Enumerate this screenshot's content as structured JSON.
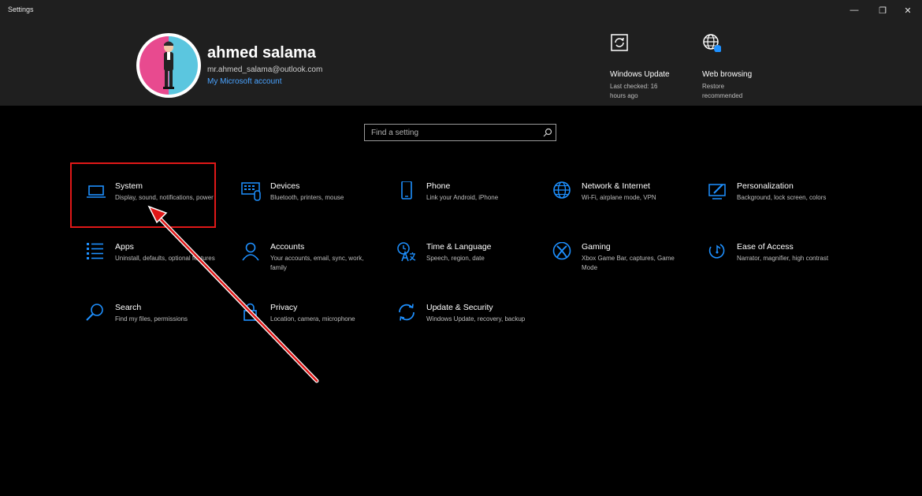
{
  "window": {
    "title": "Settings",
    "minimize": "—",
    "maximize": "❐",
    "close": "✕"
  },
  "account": {
    "name": "ahmed salama",
    "email": "mr.ahmed_salama@outlook.com",
    "link": "My Microsoft account"
  },
  "quick": [
    {
      "title": "Windows Update",
      "sub": "Last checked: 16 hours ago",
      "icon": "update-icon"
    },
    {
      "title": "Web browsing",
      "sub": "Restore recommended",
      "icon": "globe-icon"
    }
  ],
  "search": {
    "placeholder": "Find a setting"
  },
  "tiles": [
    {
      "name": "System",
      "desc": "Display, sound, notifications, power",
      "icon": "laptop-icon"
    },
    {
      "name": "Devices",
      "desc": "Bluetooth, printers, mouse",
      "icon": "keyboard-icon"
    },
    {
      "name": "Phone",
      "desc": "Link your Android, iPhone",
      "icon": "phone-icon"
    },
    {
      "name": "Network & Internet",
      "desc": "Wi-Fi, airplane mode, VPN",
      "icon": "globe-icon"
    },
    {
      "name": "Personalization",
      "desc": "Background, lock screen, colors",
      "icon": "paintbrush-icon"
    },
    {
      "name": "Apps",
      "desc": "Uninstall, defaults, optional features",
      "icon": "apps-list-icon"
    },
    {
      "name": "Accounts",
      "desc": "Your accounts, email, sync, work, family",
      "icon": "person-icon"
    },
    {
      "name": "Time & Language",
      "desc": "Speech, region, date",
      "icon": "time-language-icon"
    },
    {
      "name": "Gaming",
      "desc": "Xbox Game Bar, captures, Game Mode",
      "icon": "xbox-icon"
    },
    {
      "name": "Ease of Access",
      "desc": "Narrator, magnifier, high contrast",
      "icon": "ease-of-access-icon"
    },
    {
      "name": "Search",
      "desc": "Find my files, permissions",
      "icon": "search-icon"
    },
    {
      "name": "Privacy",
      "desc": "Location, camera, microphone",
      "icon": "lock-icon"
    },
    {
      "name": "Update & Security",
      "desc": "Windows Update, recovery, backup",
      "icon": "sync-icon"
    }
  ],
  "colors": {
    "accent": "#1e90ff",
    "highlight": "#e01818",
    "link": "#4aa3ff"
  }
}
